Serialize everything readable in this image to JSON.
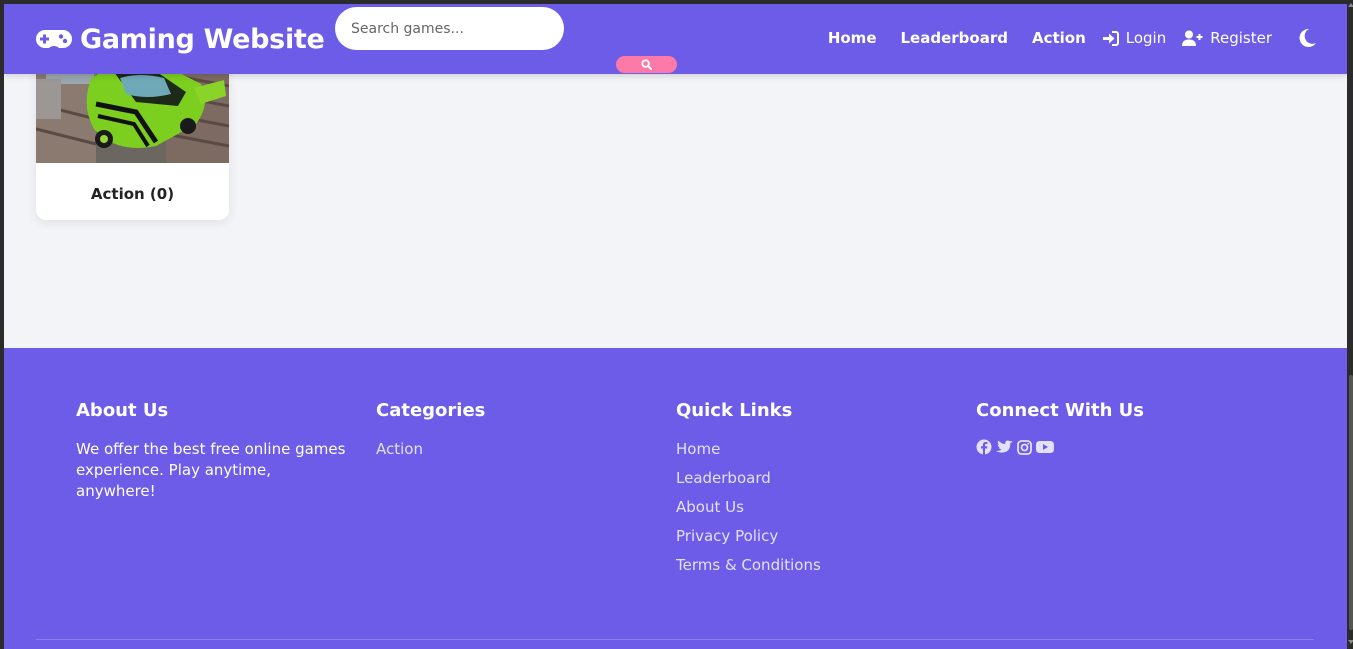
{
  "header": {
    "brand": "Gaming Website",
    "brand_icon": "gamepad-icon",
    "search": {
      "placeholder": "Search games...",
      "value": ""
    },
    "search_button_icon": "search-icon",
    "nav": [
      {
        "label": "Home"
      },
      {
        "label": "Leaderboard"
      },
      {
        "label": "Action"
      }
    ],
    "login_label": "Login",
    "login_icon": "sign-in-icon",
    "register_label": "Register",
    "register_icon": "user-plus-icon",
    "theme_icon": "moon-icon"
  },
  "categories": [
    {
      "label": "Action (0)",
      "image": "green sports car"
    }
  ],
  "footer": {
    "about": {
      "title": "About Us",
      "text": "We offer the best free online games experience. Play anytime, anywhere!"
    },
    "categories": {
      "title": "Categories",
      "links": [
        "Action"
      ]
    },
    "quick_links": {
      "title": "Quick Links",
      "links": [
        "Home",
        "Leaderboard",
        "About Us",
        "Privacy Policy",
        "Terms & Conditions"
      ]
    },
    "connect": {
      "title": "Connect With Us",
      "icons": [
        "facebook-icon",
        "twitter-icon",
        "instagram-icon",
        "youtube-icon"
      ]
    }
  },
  "colors": {
    "primary": "#6c5ce7",
    "accent": "#fd79a8",
    "background": "#f3f4f8"
  }
}
